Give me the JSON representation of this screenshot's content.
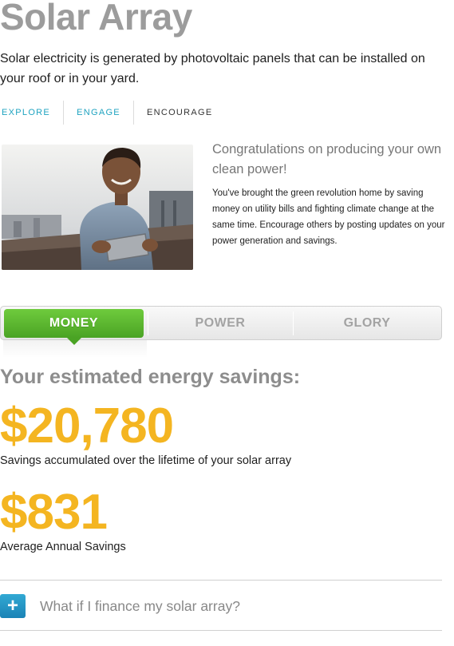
{
  "page": {
    "title": "Solar Array",
    "intro": "Solar electricity is generated by photovoltaic panels that can be installed on your roof or in your yard."
  },
  "subnav": {
    "items": [
      {
        "label": "EXPLORE"
      },
      {
        "label": "ENGAGE"
      },
      {
        "label": "ENCOURAGE"
      }
    ]
  },
  "promo": {
    "heading": "Congratulations on producing your own clean power!",
    "body": "You've brought the green revolution home by saving money on utility bills and fighting climate change at the same time. Encourage others by posting updates on your power generation and savings."
  },
  "tabs": [
    {
      "label": "MONEY",
      "active": true
    },
    {
      "label": "POWER",
      "active": false
    },
    {
      "label": "GLORY",
      "active": false
    }
  ],
  "savings": {
    "heading": "Your estimated energy savings:",
    "lifetime_value": "$20,780",
    "lifetime_label": "Savings accumulated over the lifetime of your solar array",
    "annual_value": "$831",
    "annual_label": "Average Annual Savings"
  },
  "accordion": {
    "icon": "plus-icon",
    "label": "What if I finance my solar array?"
  },
  "colors": {
    "title_gray": "#9c9c9c",
    "link_teal": "#1fa3c0",
    "active_green": "#4aa324",
    "value_yellow": "#f4b521",
    "button_blue": "#1b83b6"
  }
}
